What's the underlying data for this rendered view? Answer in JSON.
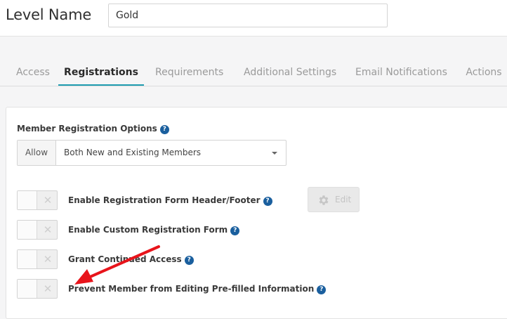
{
  "header": {
    "level_label": "Level Name",
    "level_value": "Gold"
  },
  "tabs": [
    {
      "label": "Access",
      "active": false
    },
    {
      "label": "Registrations",
      "active": true
    },
    {
      "label": "Requirements",
      "active": false
    },
    {
      "label": "Additional Settings",
      "active": false
    },
    {
      "label": "Email Notifications",
      "active": false
    },
    {
      "label": "Actions",
      "active": false
    }
  ],
  "registration": {
    "title": "Member Registration Options",
    "help_icon": "question-circle-icon",
    "allow_label": "Allow",
    "allow_value": "Both New and Existing Members",
    "options": [
      {
        "label": "Enable Registration Form Header/Footer",
        "enabled": false
      },
      {
        "label": "Enable Custom Registration Form",
        "enabled": false
      },
      {
        "label": "Grant Continued Access",
        "enabled": false
      },
      {
        "label": "Prevent Member from Editing Pre-filled Information",
        "enabled": false
      }
    ],
    "edit_button": "Edit",
    "toggle_off_glyph": "✕"
  },
  "colors": {
    "accent_tab_underline": "#1f9cb0",
    "help_icon": "#1a5f9e",
    "annotation_arrow": "#e8141b"
  }
}
